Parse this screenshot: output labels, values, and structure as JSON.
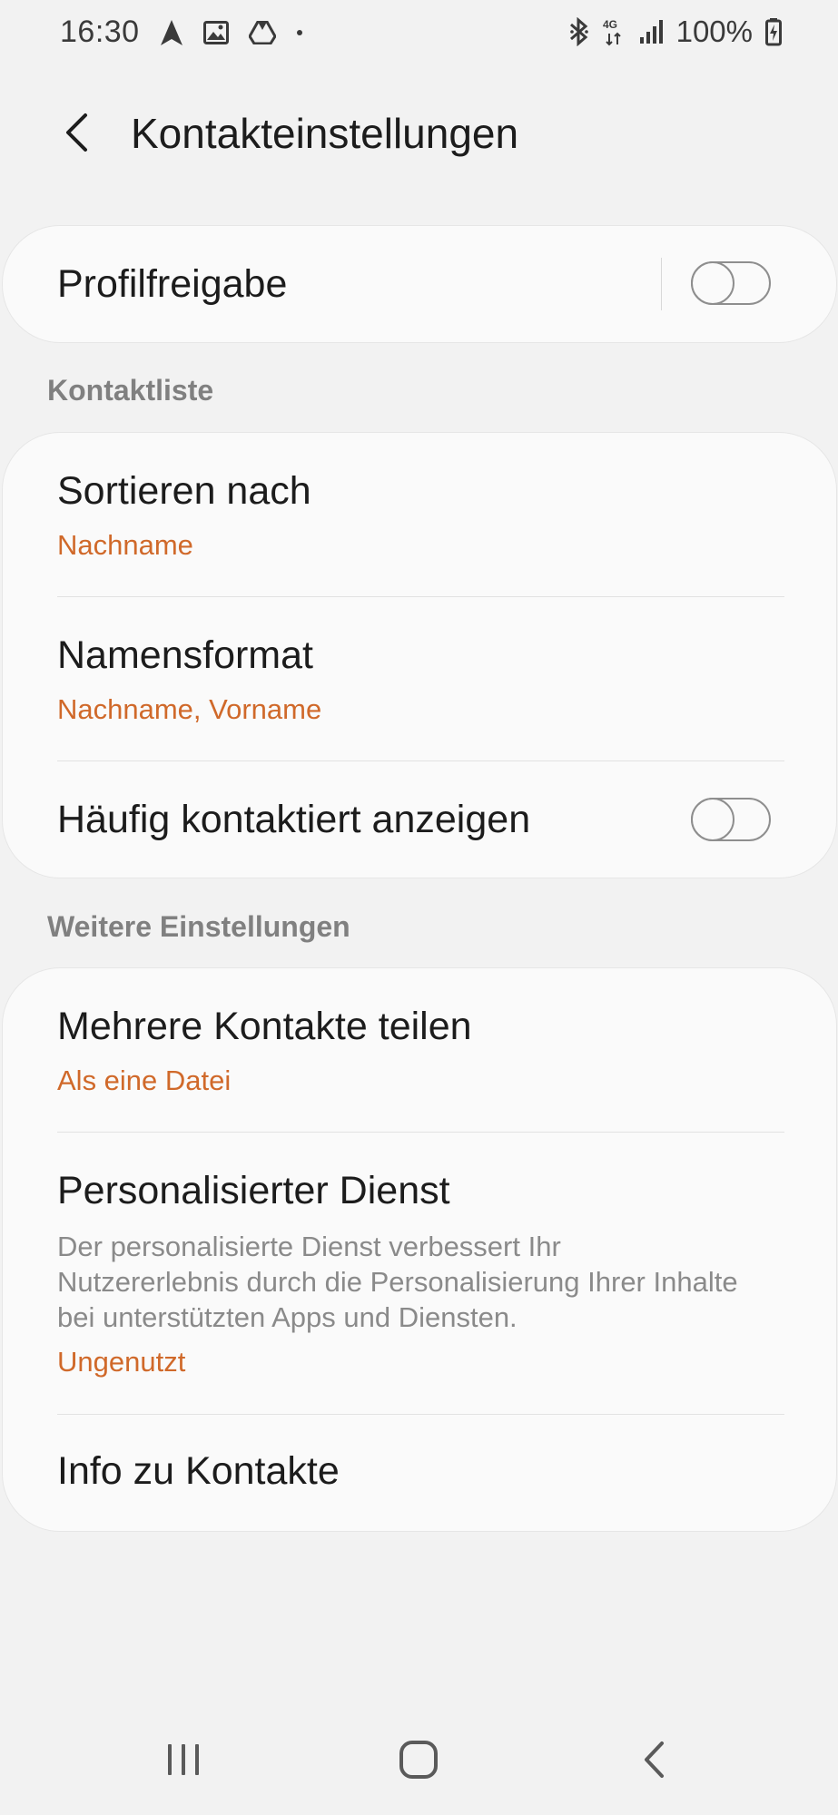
{
  "status_bar": {
    "time": "16:30",
    "left_icons": [
      "navigation-icon",
      "gallery-icon",
      "drive-icon",
      "dot-icon"
    ],
    "network": "4G",
    "battery_percent": "100%",
    "right_icons": [
      "bluetooth-icon",
      "network-4g-icon",
      "signal-icon",
      "battery-charging-icon"
    ]
  },
  "header": {
    "title": "Kontakteinstellungen",
    "back_icon": "chevron-left-icon"
  },
  "profile_card": {
    "label": "Profilfreigabe",
    "toggle_on": false
  },
  "sections": {
    "contact_list": {
      "heading": "Kontaktliste",
      "items": [
        {
          "title": "Sortieren nach",
          "value": "Nachname"
        },
        {
          "title": "Namensformat",
          "value": "Nachname, Vorname"
        },
        {
          "title": "Häufig kontaktiert anzeigen",
          "toggle_on": false
        }
      ]
    },
    "more_settings": {
      "heading": "Weitere Einstellungen",
      "items": [
        {
          "title": "Mehrere Kontakte teilen",
          "value": "Als eine Datei"
        },
        {
          "title": "Personalisierter Dienst",
          "description": "Der personalisierte Dienst verbessert Ihr Nutzererlebnis durch die Personalisierung Ihrer Inhalte bei unterstützten Apps und Diensten.",
          "value": "Ungenutzt"
        },
        {
          "title": "Info zu Kontakte"
        }
      ]
    }
  },
  "nav_bar": {
    "buttons": [
      "recents-icon",
      "home-icon",
      "back-icon"
    ]
  },
  "colors": {
    "accent": "#d0692a",
    "background": "#f2f2f2",
    "card": "#fafafa"
  }
}
